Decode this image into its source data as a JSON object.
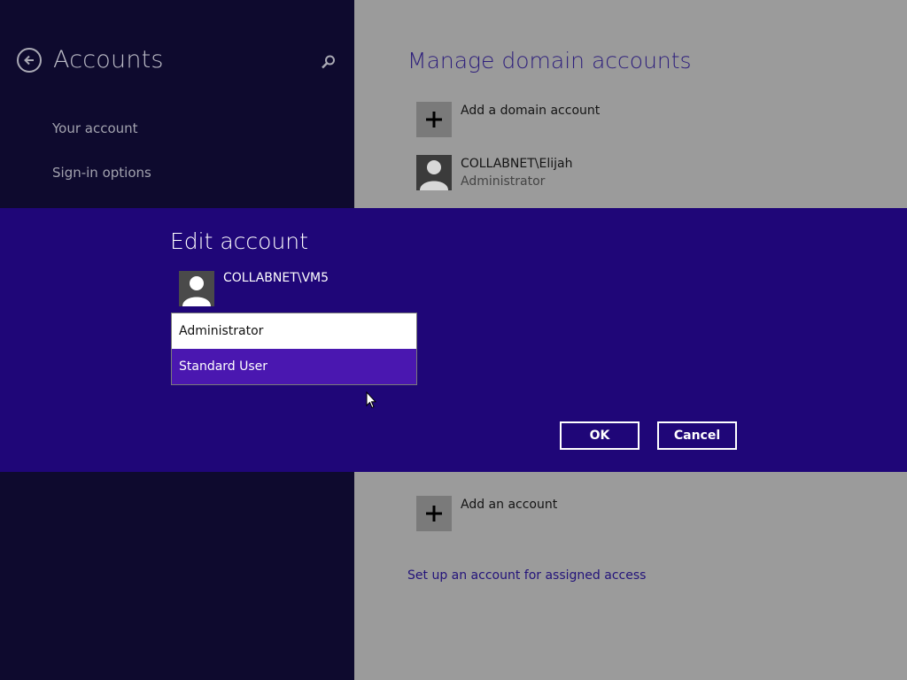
{
  "left_pane": {
    "title": "Accounts",
    "nav": [
      "Your account",
      "Sign-in options"
    ]
  },
  "right_pane": {
    "section_title": "Manage domain accounts",
    "add_domain_account": "Add a domain account",
    "existing_account": {
      "name": "COLLABNET\\Elijah",
      "role": "Administrator"
    },
    "add_account": "Add an account",
    "assigned_access_link": "Set up an account for assigned access"
  },
  "dialog": {
    "title": "Edit account",
    "username": "COLLABNET\\VM5",
    "account_type_options": [
      "Administrator",
      "Standard User"
    ],
    "highlighted_option": "Standard User",
    "ok_label": "OK",
    "cancel_label": "Cancel"
  },
  "colors": {
    "left_bg": "#0e0a2e",
    "right_bg": "#9b9b9b",
    "dialog_bg": "#1f0678",
    "highlight": "#4a17b0",
    "link": "#23137a"
  },
  "icons": [
    "back-arrow-icon",
    "search-icon",
    "plus-icon",
    "user-avatar-icon",
    "mouse-pointer-icon"
  ]
}
